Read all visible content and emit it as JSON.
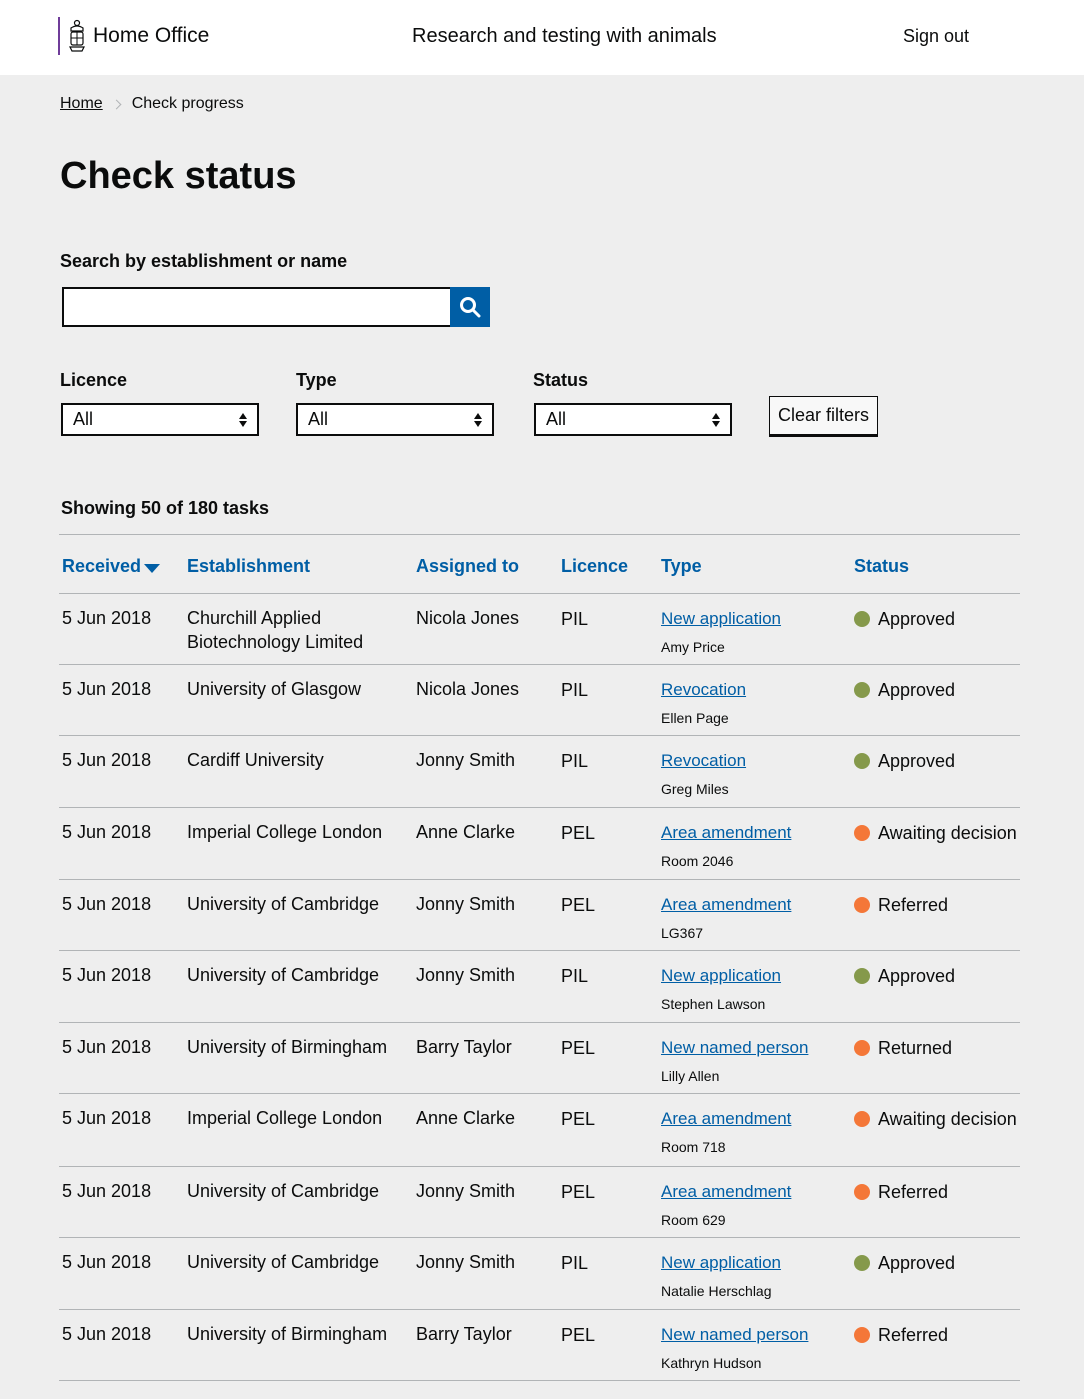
{
  "header": {
    "org_name": "Home Office",
    "service_name": "Research and testing with animals",
    "sign_out": "Sign out"
  },
  "breadcrumb": {
    "home": "Home",
    "current": "Check progress"
  },
  "page_title": "Check status",
  "search": {
    "label": "Search by establishment or name",
    "value": "",
    "placeholder": ""
  },
  "filters": {
    "licence": {
      "label": "Licence",
      "value": "All"
    },
    "type": {
      "label": "Type",
      "value": "All"
    },
    "status": {
      "label": "Status",
      "value": "All"
    },
    "clear_label": "Clear filters"
  },
  "results_summary": "Showing 50 of 180 tasks",
  "table": {
    "columns": {
      "received": "Received",
      "establishment": "Establishment",
      "assigned": "Assigned to",
      "licence": "Licence",
      "type": "Type",
      "status": "Status"
    },
    "sort": {
      "column": "received",
      "direction": "descending"
    },
    "rows": [
      {
        "date": "5 Jun 2018",
        "establishment": "Churchill Applied Biotechnology Limited",
        "assigned": "Nicola Jones",
        "licence": "PIL",
        "type": "New application",
        "subject": "Amy Price",
        "status": "Approved",
        "status_color": "#85994b"
      },
      {
        "date": "5 Jun 2018",
        "establishment": "University of Glasgow",
        "assigned": "Nicola Jones",
        "licence": "PIL",
        "type": "Revocation",
        "subject": "Ellen Page",
        "status": "Approved",
        "status_color": "#85994b"
      },
      {
        "date": "5 Jun 2018",
        "establishment": "Cardiff University",
        "assigned": "Jonny Smith",
        "licence": "PIL",
        "type": "Revocation",
        "subject": "Greg Miles",
        "status": "Approved",
        "status_color": "#85994b"
      },
      {
        "date": "5 Jun 2018",
        "establishment": "Imperial College London",
        "assigned": "Anne Clarke",
        "licence": "PEL",
        "type": "Area amendment",
        "subject": "Room 2046",
        "status": "Awaiting decision",
        "status_color": "#f47738"
      },
      {
        "date": "5 Jun 2018",
        "establishment": "University of Cambridge",
        "assigned": "Jonny Smith",
        "licence": "PEL",
        "type": "Area amendment",
        "subject": "LG367",
        "status": "Referred",
        "status_color": "#f47738"
      },
      {
        "date": "5 Jun 2018",
        "establishment": "University of Cambridge",
        "assigned": "Jonny Smith",
        "licence": "PIL",
        "type": "New application",
        "subject": "Stephen Lawson",
        "status": "Approved",
        "status_color": "#85994b"
      },
      {
        "date": "5 Jun 2018",
        "establishment": "University of Birmingham",
        "assigned": "Barry Taylor",
        "licence": "PEL",
        "type": "New named person",
        "subject": "Lilly Allen",
        "status": "Returned",
        "status_color": "#f47738"
      },
      {
        "date": "5 Jun 2018",
        "establishment": "Imperial College London",
        "assigned": "Anne Clarke",
        "licence": "PEL",
        "type": "Area amendment",
        "subject": "Room 718",
        "status": "Awaiting decision",
        "status_color": "#f47738"
      },
      {
        "date": "5 Jun 2018",
        "establishment": "University of Cambridge",
        "assigned": "Jonny Smith",
        "licence": "PEL",
        "type": "Area amendment",
        "subject": "Room 629",
        "status": "Referred",
        "status_color": "#f47738"
      },
      {
        "date": "5 Jun 2018",
        "establishment": "University of Cambridge",
        "assigned": "Jonny Smith",
        "licence": "PIL",
        "type": "New application",
        "subject": "Natalie Herschlag",
        "status": "Approved",
        "status_color": "#85994b"
      },
      {
        "date": "5 Jun 2018",
        "establishment": "University of Birmingham",
        "assigned": "Barry Taylor",
        "licence": "PEL",
        "type": "New named person",
        "subject": "Kathryn Hudson",
        "status": "Referred",
        "status_color": "#f47738"
      }
    ]
  }
}
